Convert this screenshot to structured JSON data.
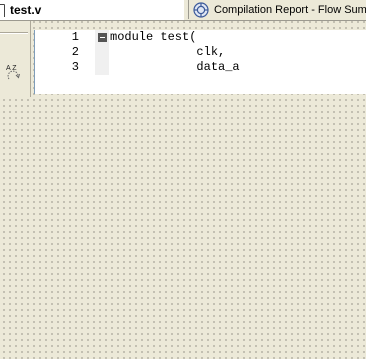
{
  "tabs": {
    "file": {
      "label": "test.v",
      "icon": "file-icon"
    },
    "report": {
      "label": "Compilation Report - Flow Summary",
      "icon": "compilation-report-icon"
    }
  },
  "toolbar": {
    "sort_icon_label": "A Z"
  },
  "editor": {
    "lines": [
      {
        "number": "1",
        "code": "module test(",
        "foldable": true
      },
      {
        "number": "2",
        "code": "            clk,",
        "foldable": false
      },
      {
        "number": "3",
        "code": "            data_a",
        "foldable": false
      }
    ]
  },
  "colors": {
    "background": "#ece9d8",
    "editor_background": "#ffffff",
    "gutter_background": "#f0f0f0"
  }
}
